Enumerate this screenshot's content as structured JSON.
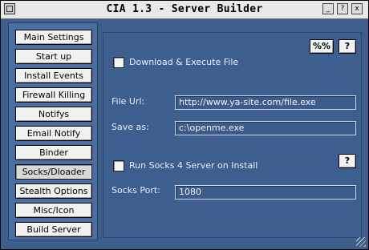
{
  "window": {
    "title": "CIA 1.3  - Server Builder",
    "controls": [
      "_",
      "?",
      "x"
    ]
  },
  "sidebar": {
    "items": [
      {
        "label": "Main Settings"
      },
      {
        "label": "Start up"
      },
      {
        "label": "Install Events"
      },
      {
        "label": "Firewall Killing"
      },
      {
        "label": "Notifys"
      },
      {
        "label": "Email Notify"
      },
      {
        "label": "Binder"
      },
      {
        "label": "Socks/Dloader",
        "active": true
      },
      {
        "label": "Stealth Options"
      },
      {
        "label": "Misc/Icon"
      },
      {
        "label": "Build Server"
      }
    ]
  },
  "panel": {
    "percent_button": "%%",
    "help_button": "?",
    "download_execute": {
      "label": "Download & Execute File",
      "checked": false
    },
    "file_url": {
      "label": "File Url:",
      "value": "http://www.ya-site.com/file.exe"
    },
    "save_as": {
      "label": "Save as:",
      "value": "c:\\openme.exe"
    },
    "socks": {
      "label": "Run Socks 4 Server on Install",
      "checked": false,
      "help_button": "?"
    },
    "socks_port": {
      "label": "Socks Port:",
      "value": "1080"
    }
  }
}
